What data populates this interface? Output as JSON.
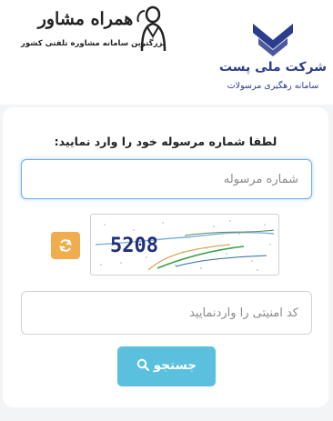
{
  "header": {
    "hamrah_logo": {
      "title": "همراه مشاور",
      "subtitle": "بزرگترین سامانه مشاوره تلفنی کشور"
    },
    "post_logo": {
      "name": "شرکت ملی پست",
      "subtitle": "سامانه رهگیری مرسولات",
      "color": "#2b3d8c"
    }
  },
  "form": {
    "prompt": "لطفا شماره مرسوله خود را وارد نمایید:",
    "parcel_input": {
      "placeholder": "شماره مرسوله",
      "value": ""
    },
    "captcha": {
      "code": "5208"
    },
    "refresh_icon": "refresh-icon",
    "security_input": {
      "placeholder": "کد امنیتی را واردنمایید",
      "value": ""
    },
    "search_button": {
      "label": "جستجو",
      "icon": "search-icon",
      "color": "#5bc0de"
    }
  }
}
